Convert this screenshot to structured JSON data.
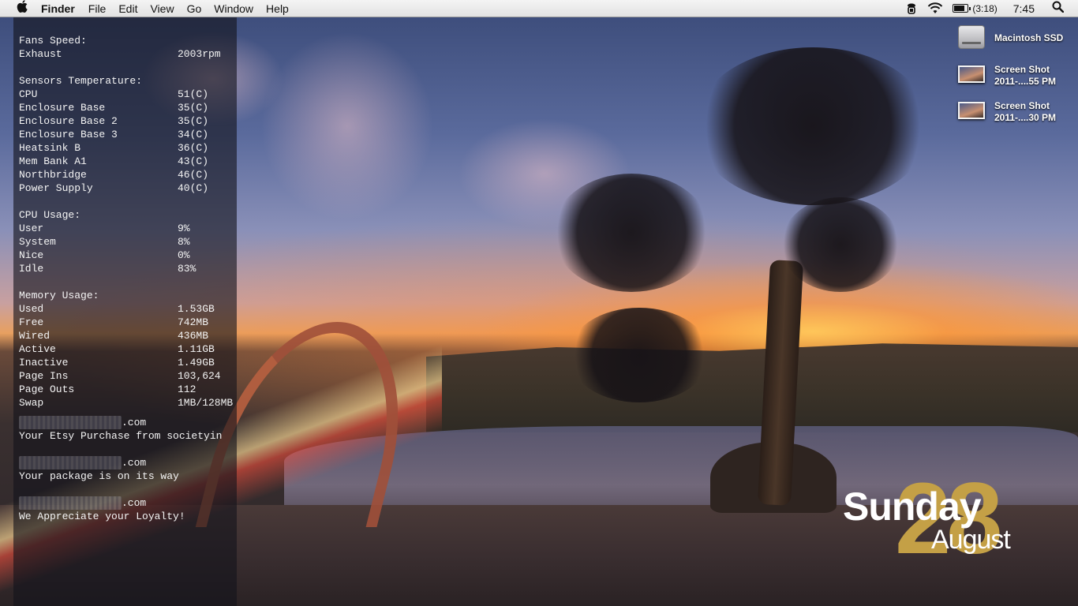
{
  "menubar": {
    "apple_icon": "",
    "items": [
      "Finder",
      "File",
      "Edit",
      "View",
      "Go",
      "Window",
      "Help"
    ],
    "battery_time": "(3:18)",
    "battery_level_fraction": 0.7,
    "clock": "7:45"
  },
  "stats": {
    "fans_header": "Fans Speed:",
    "fans": [
      {
        "label": "Exhaust",
        "value": "2003rpm"
      }
    ],
    "sensors_header": "Sensors Temperature:",
    "sensors": [
      {
        "label": "CPU",
        "value": "51(C)"
      },
      {
        "label": "Enclosure Base",
        "value": "35(C)"
      },
      {
        "label": "Enclosure Base 2",
        "value": "35(C)"
      },
      {
        "label": "Enclosure Base 3",
        "value": "34(C)"
      },
      {
        "label": "Heatsink B",
        "value": "36(C)"
      },
      {
        "label": "Mem Bank A1",
        "value": "43(C)"
      },
      {
        "label": "Northbridge",
        "value": "46(C)"
      },
      {
        "label": "Power Supply",
        "value": "40(C)"
      }
    ],
    "cpu_header": "CPU Usage:",
    "cpu": [
      {
        "label": "User",
        "value": "9%"
      },
      {
        "label": "System",
        "value": "8%"
      },
      {
        "label": "Nice",
        "value": "0%"
      },
      {
        "label": "Idle",
        "value": "83%"
      }
    ],
    "memory_header": "Memory Usage:",
    "memory": [
      {
        "label": "Used",
        "value": "1.53GB"
      },
      {
        "label": "Free",
        "value": "742MB"
      },
      {
        "label": "Wired",
        "value": "436MB"
      },
      {
        "label": "Active",
        "value": "1.11GB"
      },
      {
        "label": "Inactive",
        "value": "1.49GB"
      },
      {
        "label": "Page Ins",
        "value": "103,624"
      },
      {
        "label": "Page Outs",
        "value": "112"
      },
      {
        "label": "Swap",
        "value": "1MB/128MB"
      }
    ]
  },
  "mail": [
    {
      "sender_suffix": ".com",
      "subject": "Your Etsy Purchase from societyin"
    },
    {
      "sender_suffix": ".com",
      "subject": "Your package is on its way"
    },
    {
      "sender_suffix": ".com",
      "subject": "We Appreciate your Loyalty!"
    }
  ],
  "desktop_icons": [
    {
      "line1": "Macintosh SSD",
      "line2": "",
      "icon": "hard-drive-icon"
    },
    {
      "line1": "Screen Shot",
      "line2": "2011-....55 PM",
      "icon": "screenshot-thumbnail-icon"
    },
    {
      "line1": "Screen Shot",
      "line2": "2011-....30 PM",
      "icon": "screenshot-thumbnail-icon"
    }
  ],
  "date_widget": {
    "weekday": "Sunday",
    "day": "28",
    "month": "August"
  },
  "colors": {
    "date_gold": "#c4a046",
    "panel_bg": "rgba(20,20,28,0.62)"
  }
}
